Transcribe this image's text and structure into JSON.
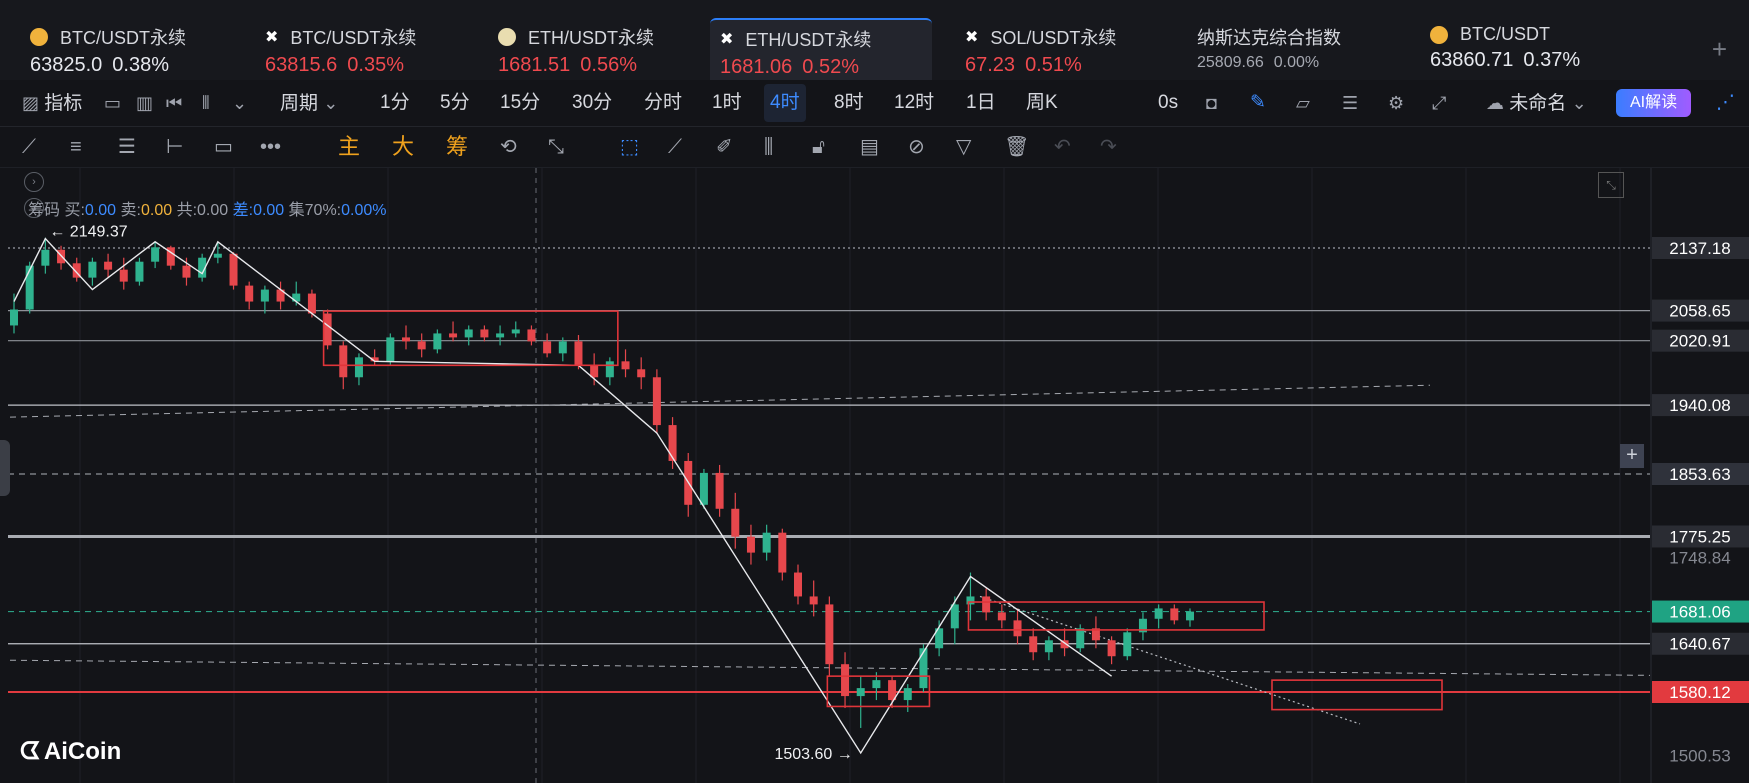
{
  "tabs": [
    {
      "icon": "btc",
      "name": "BTC/USDT永续",
      "price": "63825.0",
      "change": "0.38%",
      "tone": "white",
      "x": 30
    },
    {
      "icon": "x",
      "name": "BTC/USDT永续",
      "price": "63815.6",
      "change": "0.35%",
      "tone": "red",
      "x": 265
    },
    {
      "icon": "eth",
      "name": "ETH/USDT永续",
      "price": "1681.51",
      "change": "0.56%",
      "tone": "red",
      "x": 498
    },
    {
      "icon": "x",
      "name": "ETH/USDT永续",
      "price": "1681.06",
      "change": "0.52%",
      "tone": "red",
      "x": 720,
      "active": true
    },
    {
      "icon": "x",
      "name": "SOL/USDT永续",
      "price": "67.23",
      "change": "0.51%",
      "tone": "red",
      "x": 965
    },
    {
      "icon": "none",
      "name": "纳斯达克综合指数",
      "price": "25809.66",
      "change": "0.00%",
      "tone": "gray",
      "x": 1197
    },
    {
      "icon": "btc",
      "name": "BTC/USDT",
      "price": "63860.71",
      "change": "0.37%",
      "tone": "white",
      "x": 1430
    }
  ],
  "add_tab": "+",
  "toolbar": {
    "indicator": "指标",
    "period": "周期",
    "intervals": [
      "1分",
      "5分",
      "15分",
      "30分",
      "分时",
      "1时",
      "4时",
      "8时",
      "12时",
      "1日",
      "周K"
    ],
    "active_interval": "4时",
    "countdown": "0s",
    "layout_name": "未命名",
    "ai_button": "AI解读"
  },
  "drawbar": {
    "main": "主",
    "big": "大",
    "chips": "筹"
  },
  "chip_panel": {
    "label": "筹码",
    "buy_label": "买:",
    "buy": "0.00",
    "sell_label": "卖:",
    "sell": "0.00",
    "total_label": "共:",
    "total": "0.00",
    "diff_label": "差:",
    "diff": "0.00",
    "concentration_label": "集70%:",
    "concentration": "0.00%"
  },
  "logo": "AiCoin",
  "chart_data": {
    "type": "candlestick",
    "symbol": "ETH/USDT永续",
    "interval": "4时",
    "ylim": [
      1490,
      2200
    ],
    "high_label": "2149.37",
    "low_label": "1503.60",
    "price_levels": [
      {
        "price": 2137.18,
        "label": "2137.18",
        "style": "dotted",
        "color": "#9a9ea6",
        "box": "#2a2c33"
      },
      {
        "price": 2058.65,
        "label": "2058.65",
        "style": "solid",
        "color": "#8f9299",
        "box": "#2a2c33"
      },
      {
        "price": 2020.91,
        "label": "2020.91",
        "style": "solid",
        "color": "#8f9299",
        "box": "#2a2c33"
      },
      {
        "price": 1940.08,
        "label": "1940.08",
        "style": "solid",
        "color": "#bfc2c8",
        "box": "#2a2c33"
      },
      {
        "price": 1853.63,
        "label": "1853.63",
        "style": "dashed",
        "color": "#8f9299",
        "box": "#2f323b"
      },
      {
        "price": 1775.25,
        "label": "1775.25",
        "style": "solid-thick",
        "color": "#a9acb2",
        "box": "#2a2c33"
      },
      {
        "price": 1681.06,
        "label": "1681.06",
        "style": "dashed",
        "color": "#2b9f84",
        "box": "#1fa383"
      },
      {
        "price": 1640.67,
        "label": "1640.67",
        "style": "solid",
        "color": "#bfc2c8",
        "box": "#2a2c33"
      },
      {
        "price": 1580.12,
        "label": "1580.12",
        "style": "solid",
        "color": "#e23a3f",
        "box": "#e23a3f"
      }
    ],
    "axis_ticks": [
      {
        "price": 1748.84,
        "label": "1748.84"
      },
      {
        "price": 1500.53,
        "label": "1500.53"
      }
    ],
    "candles": [
      [
        2040,
        2080,
        2030,
        2060
      ],
      [
        2060,
        2120,
        2055,
        2115
      ],
      [
        2115,
        2150,
        2105,
        2135
      ],
      [
        2135,
        2140,
        2110,
        2118
      ],
      [
        2118,
        2125,
        2095,
        2100
      ],
      [
        2100,
        2125,
        2090,
        2120
      ],
      [
        2120,
        2130,
        2100,
        2110
      ],
      [
        2110,
        2125,
        2085,
        2095
      ],
      [
        2095,
        2125,
        2090,
        2120
      ],
      [
        2120,
        2145,
        2112,
        2138
      ],
      [
        2138,
        2140,
        2110,
        2115
      ],
      [
        2115,
        2125,
        2090,
        2100
      ],
      [
        2100,
        2130,
        2095,
        2125
      ],
      [
        2125,
        2145,
        2118,
        2130
      ],
      [
        2130,
        2132,
        2085,
        2090
      ],
      [
        2090,
        2095,
        2060,
        2070
      ],
      [
        2070,
        2090,
        2055,
        2085
      ],
      [
        2085,
        2095,
        2060,
        2070
      ],
      [
        2070,
        2095,
        2065,
        2080
      ],
      [
        2080,
        2085,
        2050,
        2055
      ],
      [
        2055,
        2060,
        2010,
        2015
      ],
      [
        2015,
        2020,
        1960,
        1975
      ],
      [
        1975,
        2005,
        1965,
        2000
      ],
      [
        2000,
        2010,
        1990,
        1995
      ],
      [
        1995,
        2030,
        1990,
        2025
      ],
      [
        2025,
        2040,
        2010,
        2020
      ],
      [
        2020,
        2030,
        2000,
        2010
      ],
      [
        2010,
        2035,
        2005,
        2030
      ],
      [
        2030,
        2045,
        2020,
        2025
      ],
      [
        2025,
        2040,
        2015,
        2035
      ],
      [
        2035,
        2040,
        2020,
        2025
      ],
      [
        2025,
        2040,
        2015,
        2030
      ],
      [
        2030,
        2045,
        2025,
        2035
      ],
      [
        2035,
        2040,
        2015,
        2020
      ],
      [
        2020,
        2030,
        2000,
        2005
      ],
      [
        2005,
        2025,
        1995,
        2020
      ],
      [
        2020,
        2028,
        1985,
        1990
      ],
      [
        1990,
        2005,
        1965,
        1975
      ],
      [
        1975,
        2000,
        1965,
        1995
      ],
      [
        1995,
        2010,
        1975,
        1985
      ],
      [
        1985,
        2000,
        1960,
        1975
      ],
      [
        1975,
        1985,
        1905,
        1915
      ],
      [
        1915,
        1925,
        1860,
        1870
      ],
      [
        1870,
        1880,
        1800,
        1815
      ],
      [
        1815,
        1860,
        1810,
        1855
      ],
      [
        1855,
        1865,
        1800,
        1810
      ],
      [
        1810,
        1830,
        1760,
        1775
      ],
      [
        1775,
        1790,
        1740,
        1755
      ],
      [
        1755,
        1790,
        1745,
        1780
      ],
      [
        1780,
        1785,
        1720,
        1730
      ],
      [
        1730,
        1740,
        1690,
        1700
      ],
      [
        1700,
        1720,
        1675,
        1690
      ],
      [
        1690,
        1700,
        1600,
        1615
      ],
      [
        1615,
        1630,
        1560,
        1575
      ],
      [
        1575,
        1600,
        1535,
        1585
      ],
      [
        1585,
        1605,
        1570,
        1595
      ],
      [
        1595,
        1600,
        1560,
        1570
      ],
      [
        1570,
        1590,
        1555,
        1585
      ],
      [
        1585,
        1640,
        1580,
        1635
      ],
      [
        1635,
        1670,
        1625,
        1660
      ],
      [
        1660,
        1700,
        1640,
        1690
      ],
      [
        1690,
        1730,
        1670,
        1700
      ],
      [
        1700,
        1710,
        1670,
        1680
      ],
      [
        1680,
        1690,
        1660,
        1670
      ],
      [
        1670,
        1685,
        1640,
        1650
      ],
      [
        1650,
        1660,
        1620,
        1630
      ],
      [
        1630,
        1650,
        1620,
        1645
      ],
      [
        1645,
        1660,
        1625,
        1635
      ],
      [
        1635,
        1665,
        1630,
        1660
      ],
      [
        1660,
        1675,
        1635,
        1645
      ],
      [
        1645,
        1650,
        1615,
        1625
      ],
      [
        1625,
        1660,
        1620,
        1655
      ],
      [
        1655,
        1680,
        1645,
        1672
      ],
      [
        1672,
        1690,
        1660,
        1685
      ],
      [
        1685,
        1690,
        1665,
        1670
      ],
      [
        1670,
        1685,
        1662,
        1681
      ]
    ]
  }
}
